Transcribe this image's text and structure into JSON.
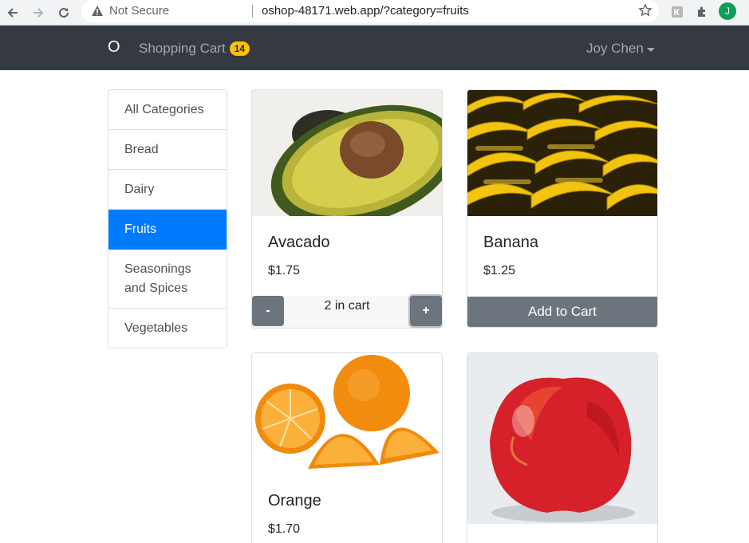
{
  "browser": {
    "security_label": "Not Secure",
    "url": "oshop-48171.web.app/?category=fruits",
    "profile_initial": "J"
  },
  "navbar": {
    "brand": "O",
    "cart_label": "Shopping Cart",
    "cart_count": "14",
    "user_name": "Joy Chen"
  },
  "categories": [
    {
      "label": "All Categories",
      "active": false
    },
    {
      "label": "Bread",
      "active": false
    },
    {
      "label": "Dairy",
      "active": false
    },
    {
      "label": "Fruits",
      "active": true
    },
    {
      "label": "Seasonings and Spices",
      "active": false
    },
    {
      "label": "Vegetables",
      "active": false
    }
  ],
  "products": [
    {
      "title": "Avacado",
      "price": "$1.75",
      "minus_label": "-",
      "plus_label": "+",
      "cart_status": "2 in cart"
    },
    {
      "title": "Banana",
      "price": "$1.25",
      "add_label": "Add to Cart"
    },
    {
      "title": "Orange",
      "price": "$1.70"
    },
    {
      "title": "",
      "price": ""
    }
  ],
  "colors": {
    "navbar_bg": "#343a40",
    "active_category": "#007bff",
    "badge": "#ffc107",
    "button": "#6c757d"
  }
}
